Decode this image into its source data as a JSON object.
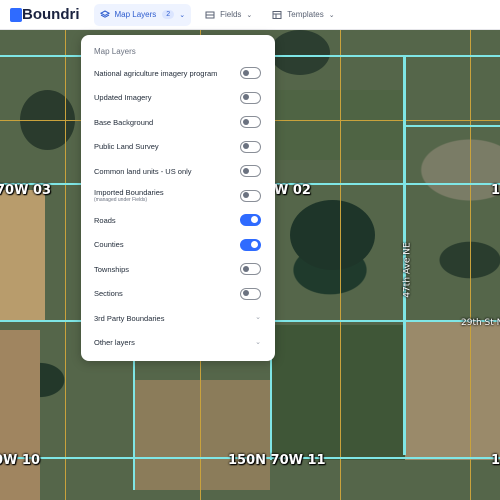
{
  "app": {
    "logo_text": "Boundri",
    "brand_color": "#2f6bff"
  },
  "nav": [
    {
      "label": "Map Layers",
      "badge": "2",
      "icon": "layers-icon",
      "active": true
    },
    {
      "label": "Fields",
      "icon": "fields-icon",
      "active": false
    },
    {
      "label": "Templates",
      "icon": "templates-icon",
      "active": false
    }
  ],
  "panel": {
    "title": "Map Layers",
    "layers": [
      {
        "label": "National agriculture imagery program",
        "on": false
      },
      {
        "label": "Updated Imagery",
        "on": false
      },
      {
        "label": "Base Background",
        "on": false
      },
      {
        "label": "Public Land Survey",
        "on": false
      },
      {
        "label": "Common land units - US only",
        "on": false
      },
      {
        "label": "Imported Boundaries",
        "sub": "(managed under Fields)",
        "on": false
      },
      {
        "label": "Roads",
        "on": true
      },
      {
        "label": "Counties",
        "on": true
      },
      {
        "label": "Townships",
        "on": false
      },
      {
        "label": "Sections",
        "on": false
      }
    ],
    "groups": [
      {
        "label": "3rd Party Boundaries"
      },
      {
        "label": "Other layers"
      }
    ]
  },
  "map": {
    "township_labels": [
      "70W 03",
      "W 02",
      "1",
      "0W 10",
      "150N 70W 11",
      "1"
    ],
    "road_labels": [
      "29th St N",
      "47th Ave NE"
    ]
  },
  "colors": {
    "boundary": "#7fe6e6",
    "section_line": "#c9a23c",
    "toggle_on": "#2f6bff"
  }
}
